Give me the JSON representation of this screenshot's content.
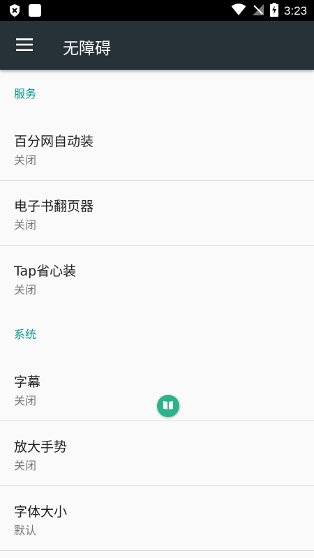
{
  "status_bar": {
    "time": "3:23",
    "icons": [
      "shield-x-icon",
      "square-notification-icon",
      "wifi-icon",
      "no-signal-icon",
      "battery-charging-icon"
    ]
  },
  "toolbar": {
    "menu_icon": "hamburger-menu-icon",
    "title": "无障碍"
  },
  "sections": [
    {
      "header": "服务",
      "items": [
        {
          "title": "百分网自动装",
          "summary": "关闭"
        },
        {
          "title": "电子书翻页器",
          "summary": "关闭"
        },
        {
          "title": "Tap省心装",
          "summary": "关闭"
        }
      ]
    },
    {
      "header": "系统",
      "items": [
        {
          "title": "字幕",
          "summary": "关闭"
        },
        {
          "title": "放大手势",
          "summary": "关闭"
        },
        {
          "title": "字体大小",
          "summary": "默认"
        }
      ]
    }
  ],
  "floating_button": {
    "icon": "book-icon"
  },
  "colors": {
    "accent": "#009688",
    "toolbar": "#263238",
    "floating_button": "#2bb489"
  }
}
